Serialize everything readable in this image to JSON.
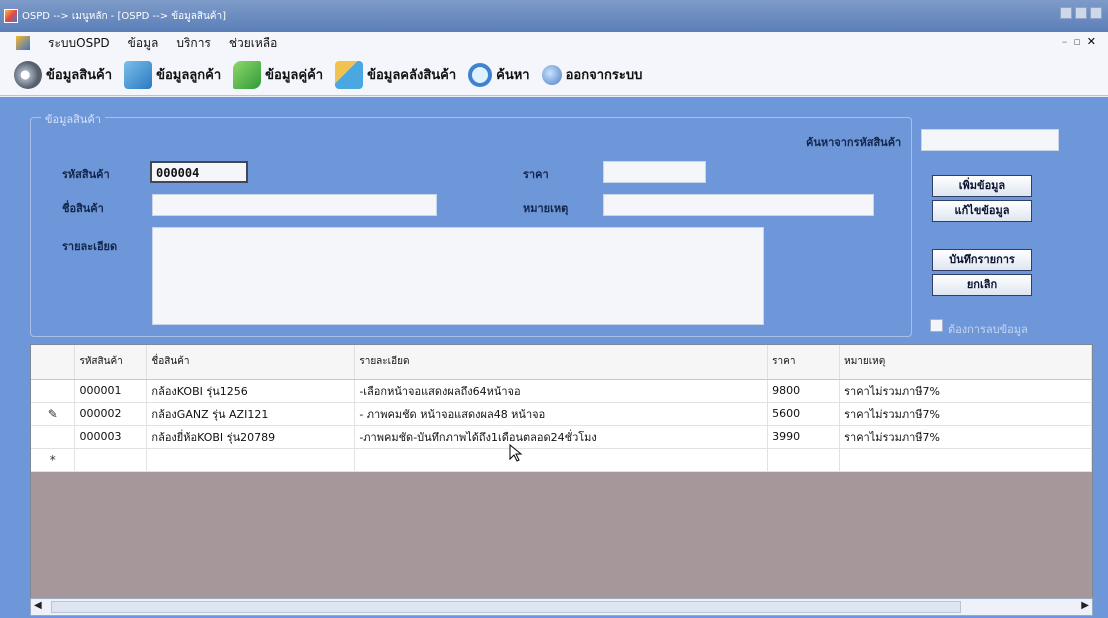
{
  "window": {
    "title": "OSPD --> เมนูหลัก - [OSPD --> ข้อมูลสินค้า]"
  },
  "menu": [
    "ระบบOSPD",
    "ข้อมูล",
    "บริการ",
    "ช่วยเหลือ"
  ],
  "toolbar": {
    "product": "ข้อมูลสินค้า",
    "customer": "ข้อมูลลูกค้า",
    "partner": "ข้อมูลคู่ค้า",
    "stock": "ข้อมูลคลังสินค้า",
    "search": "ค้นหา",
    "exit": "ออกจากระบบ"
  },
  "form": {
    "group_title": "ข้อมูลสินค้า",
    "search_label": "ค้นหาจากรหัสสินค้า",
    "search_value": "",
    "code_label": "รหัสสินค้า",
    "code_value": "000004",
    "name_label": "ชื่อสินค้า",
    "name_value": "",
    "detail_label": "รายละเอียด",
    "detail_value": "",
    "price_label": "ราคา",
    "price_value": "",
    "note_label": "หมายเหตุ",
    "note_value": "",
    "add_button": "เพิ่มข้อมูล",
    "edit_button": "แก้ไขข้อมูล",
    "save_button": "บันทึกรายการ",
    "cancel_button": "ยกเลิก",
    "delete_check_label": "ต้องการลบข้อมูล"
  },
  "grid": {
    "columns": [
      "รหัสสินค้า",
      "ชื่อสินค้า",
      "รายละเอียด",
      "ราคา",
      "หมายเหตุ"
    ],
    "rows": [
      {
        "marker": "",
        "code": "000001",
        "name": "กล้องKOBI รุ่น1256",
        "detail": "-เลือกหน้าจอแสดงผลถึง64หน้าจอ",
        "price": "9800",
        "note": "ราคาไม่รวมภาษี7%"
      },
      {
        "marker": "✎",
        "code": "000002",
        "name": "กล้องGANZ รุ่น AZI121",
        "detail": "- ภาพคมชัด หน้าจอแสดงผล48 หน้าจอ",
        "price": "5600",
        "note": "ราคาไม่รวมภาษี7%"
      },
      {
        "marker": "",
        "code": "000003",
        "name": "กล้องยี่ห้อKOBI รุ่น20789",
        "detail": "-ภาพคมชัด-บันทึกภาพได้ถึง1เดือนตลอด24ชั่วโมง",
        "price": "3990",
        "note": "ราคาไม่รวมภาษี7%"
      }
    ],
    "new_row_marker": "*"
  }
}
